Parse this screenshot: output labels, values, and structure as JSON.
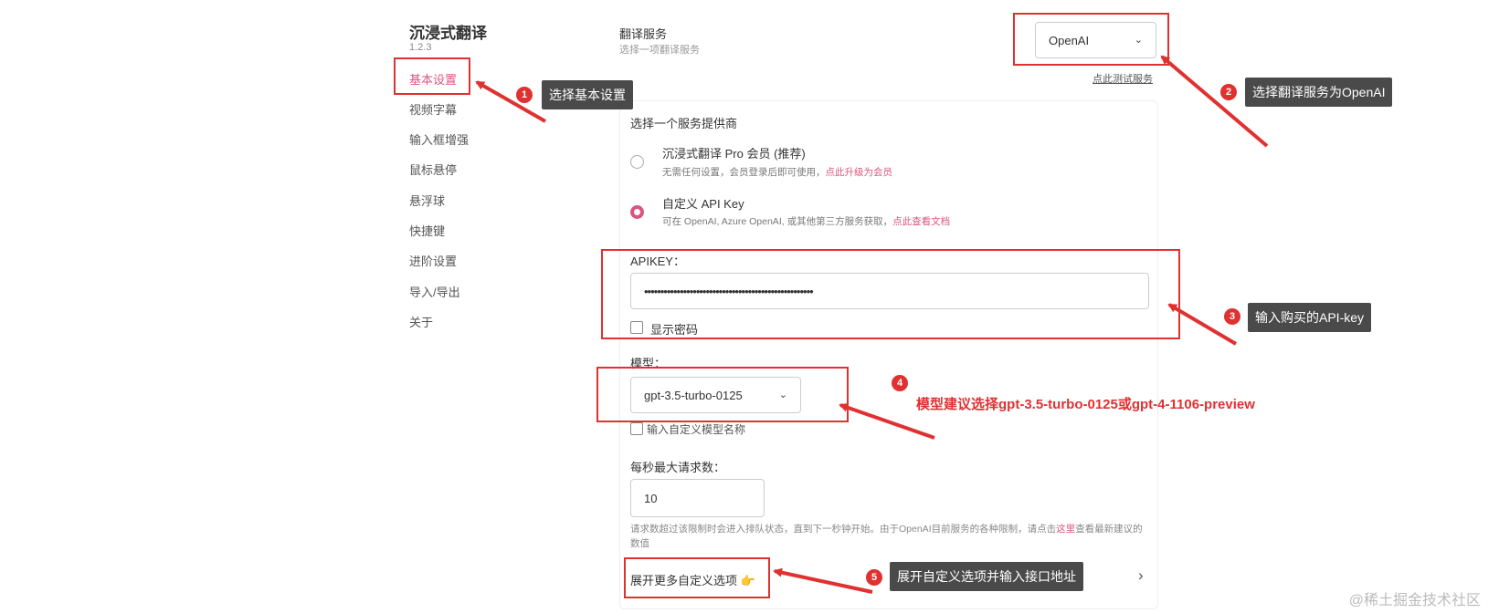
{
  "sidebar": {
    "app_title": "沉浸式翻译",
    "version": "1.2.3",
    "items": [
      {
        "label": "基本设置",
        "active": true
      },
      {
        "label": "视频字幕"
      },
      {
        "label": "输入框增强"
      },
      {
        "label": "鼠标悬停"
      },
      {
        "label": "悬浮球"
      },
      {
        "label": "快捷键"
      },
      {
        "label": "进阶设置"
      },
      {
        "label": "导入/导出"
      },
      {
        "label": "关于"
      }
    ]
  },
  "service": {
    "title": "翻译服务",
    "subtitle": "选择一项翻译服务",
    "selected": "OpenAI",
    "test_link": "点此测试服务"
  },
  "provider": {
    "heading": "选择一个服务提供商",
    "options": [
      {
        "title": "沉浸式翻译 Pro 会员 (推荐)",
        "hint": "无需任何设置，会员登录后即可使用，",
        "link": "点此升级为会员",
        "checked": false
      },
      {
        "title": "自定义 API Key",
        "hint": "可在 OpenAI, Azure OpenAI, 或其他第三方服务获取，",
        "link": "点此查看文档",
        "checked": true
      }
    ]
  },
  "apikey": {
    "label": "APIKEY：",
    "value": "••••••••••••••••••••••••••••••••••••••••••••••••••••",
    "show_password_label": "显示密码",
    "show_password_checked": false
  },
  "model": {
    "label": "模型：",
    "selected": "gpt-3.5-turbo-0125",
    "custom_label": "输入自定义模型名称",
    "custom_checked": false
  },
  "rate": {
    "label": "每秒最大请求数：",
    "value": "10",
    "hint_part1": "请求数超过该限制时会进入排队状态，直到下一秒钟开始。由于OpenAI目前服务的各种限制，请点击",
    "hint_link": "这里",
    "hint_part2": "查看最新建议的数值"
  },
  "expand": {
    "label": "展开更多自定义选项",
    "emoji": "👉"
  },
  "annotations": [
    {
      "num": "1",
      "text": "选择基本设置"
    },
    {
      "num": "2",
      "text": "选择翻译服务为OpenAI"
    },
    {
      "num": "3",
      "text": "输入购买的API-key"
    },
    {
      "num": "4",
      "text": "模型建议选择gpt-3.5-turbo-0125或gpt-4-1106-preview"
    },
    {
      "num": "5",
      "text": "展开自定义选项并输入接口地址"
    }
  ],
  "watermark": "@稀土掘金技术社区",
  "colors": {
    "accent": "#d9577f",
    "annotation_red": "#e03131",
    "callout_bg": "#4a4a4a"
  },
  "icons": {
    "dropdown": "chevron-down-icon",
    "expand": "chevron-right-icon"
  }
}
